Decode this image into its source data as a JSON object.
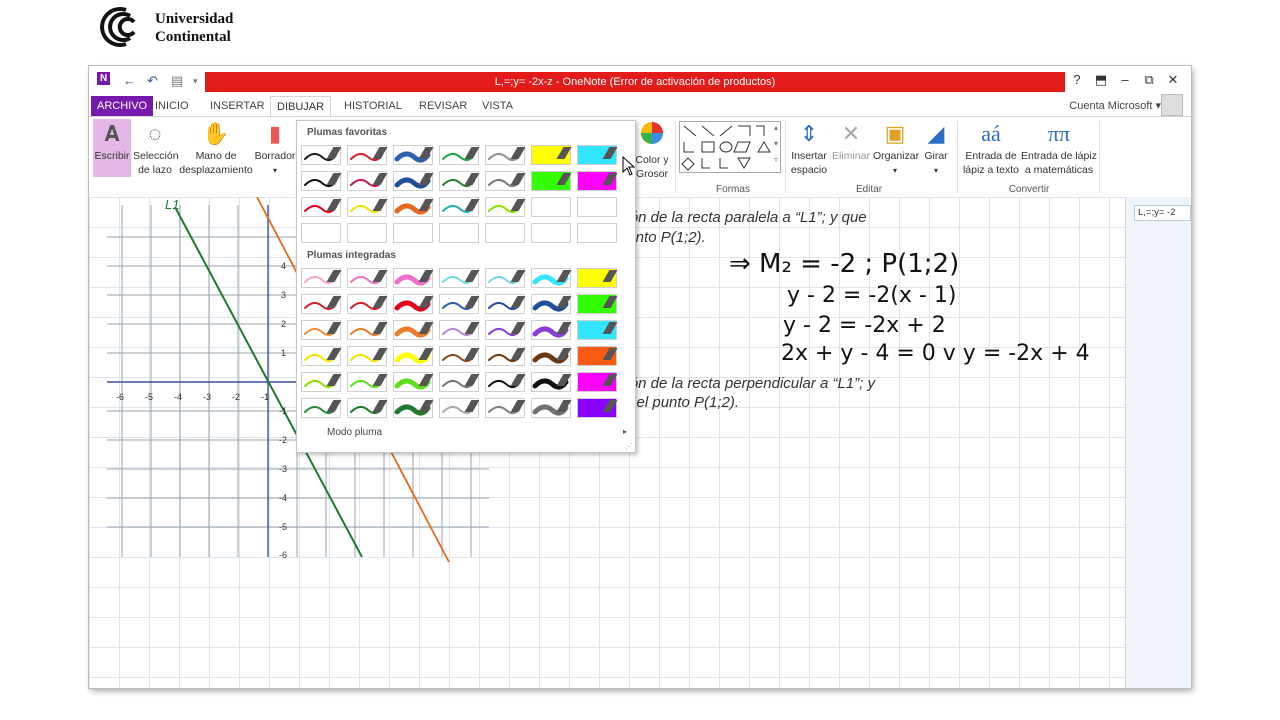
{
  "logo": {
    "line1": "Universidad",
    "line2": "Continental"
  },
  "window": {
    "title": "L,=;y= -2x-z - OneNote (Error de activación de productos)",
    "help": "?",
    "account": "Cuenta Microsoft"
  },
  "tabs": [
    {
      "label": "ARCHIVO"
    },
    {
      "label": "INICIO"
    },
    {
      "label": "INSERTAR"
    },
    {
      "label": "DIBUJAR"
    },
    {
      "label": "HISTORIAL"
    },
    {
      "label": "REVISAR"
    },
    {
      "label": "VISTA"
    }
  ],
  "ribbon": {
    "escribir": "Escribir",
    "lazo": [
      "Selección",
      "de lazo"
    ],
    "mano": [
      "Mano de",
      "desplazamiento"
    ],
    "borrador": "Borrador",
    "color_grosor": [
      "Color y",
      "Grosor"
    ],
    "formas_group": "Formas",
    "insertar_espacio": [
      "Insertar",
      "espacio"
    ],
    "eliminar": "Eliminar",
    "organizar": "Organizar",
    "girar": "Girar",
    "editar_group": "Editar",
    "entrada_texto": [
      "Entrada de",
      "lápiz a texto"
    ],
    "entrada_matematicas": [
      "Entrada de lápiz",
      "a matemáticas"
    ],
    "convertir_group": "Convertir"
  },
  "pens_panel": {
    "favoritas": "Plumas favoritas",
    "integradas": "Plumas integradas",
    "modo": "Modo pluma",
    "favorite_colors": [
      [
        "#222222",
        "#d4202a",
        "#2e60b0",
        "#1aa64a",
        "#909090",
        "#ffff00",
        "#33e6ff"
      ],
      [
        "#111111",
        "#c2185b",
        "#1f4e9a",
        "#2e7d32",
        "#777777",
        "#33ff00",
        "#ff00ff"
      ],
      [
        "#e3001b",
        "#f2e200",
        "#e5691b",
        "#1fb2b2",
        "#90e000",
        "",
        ""
      ],
      [
        "",
        "",
        "",
        "",
        "",
        "",
        ""
      ]
    ],
    "integrated_colors": [
      [
        "#f4a6c9",
        "#f06ec8",
        "#f06ec8",
        "#71e0e0",
        "#7ad6e8",
        "#33e6ff",
        "#ffff00"
      ],
      [
        "#d4202a",
        "#d4202a",
        "#e3001b",
        "#2e60b0",
        "#1f4e9a",
        "#1f4e9a",
        "#33ff00"
      ],
      [
        "#f2933a",
        "#f07b2a",
        "#f07b2a",
        "#b48ad8",
        "#8a3cd8",
        "#8a3cd8",
        "#33e6ff"
      ],
      [
        "#f2e200",
        "#f2e200",
        "#ffff00",
        "#8b4a1a",
        "#6b3a10",
        "#6b3a10",
        "#ff5a14"
      ],
      [
        "#90e000",
        "#5de01b",
        "#5de01b",
        "#777777",
        "#111111",
        "#111111",
        "#ff00ff"
      ],
      [
        "#2e8b3a",
        "#1f7a2e",
        "#1f7a2e",
        "#aaaaaa",
        "#808080",
        "#707070",
        "#8a00ff"
      ]
    ]
  },
  "note": {
    "text1": "ción de la recta paralela a “L1”; y que",
    "text2": "punto P(1;2).",
    "math1": "⇒ M₂ = -2 ; P(1;2)",
    "math2": "y - 2 = -2(x - 1)",
    "math3": "y - 2 = -2x + 2",
    "math4": "2x + y - 4 = 0  v  y = -2x + 4",
    "text3": "ción de la recta perpendicular a “L1”; y",
    "text4": "or el punto P(1;2)."
  },
  "graph": {
    "x_ticks": [
      "-6",
      "-5",
      "-4",
      "-3",
      "-2",
      "-1"
    ],
    "y_ticks": [
      "4",
      "3",
      "2",
      "1",
      "-1",
      "-2",
      "-3",
      "-4",
      "-5",
      "-6"
    ],
    "line_label": "L1"
  },
  "pages_pane": {
    "page": "L,=;y= -2"
  }
}
